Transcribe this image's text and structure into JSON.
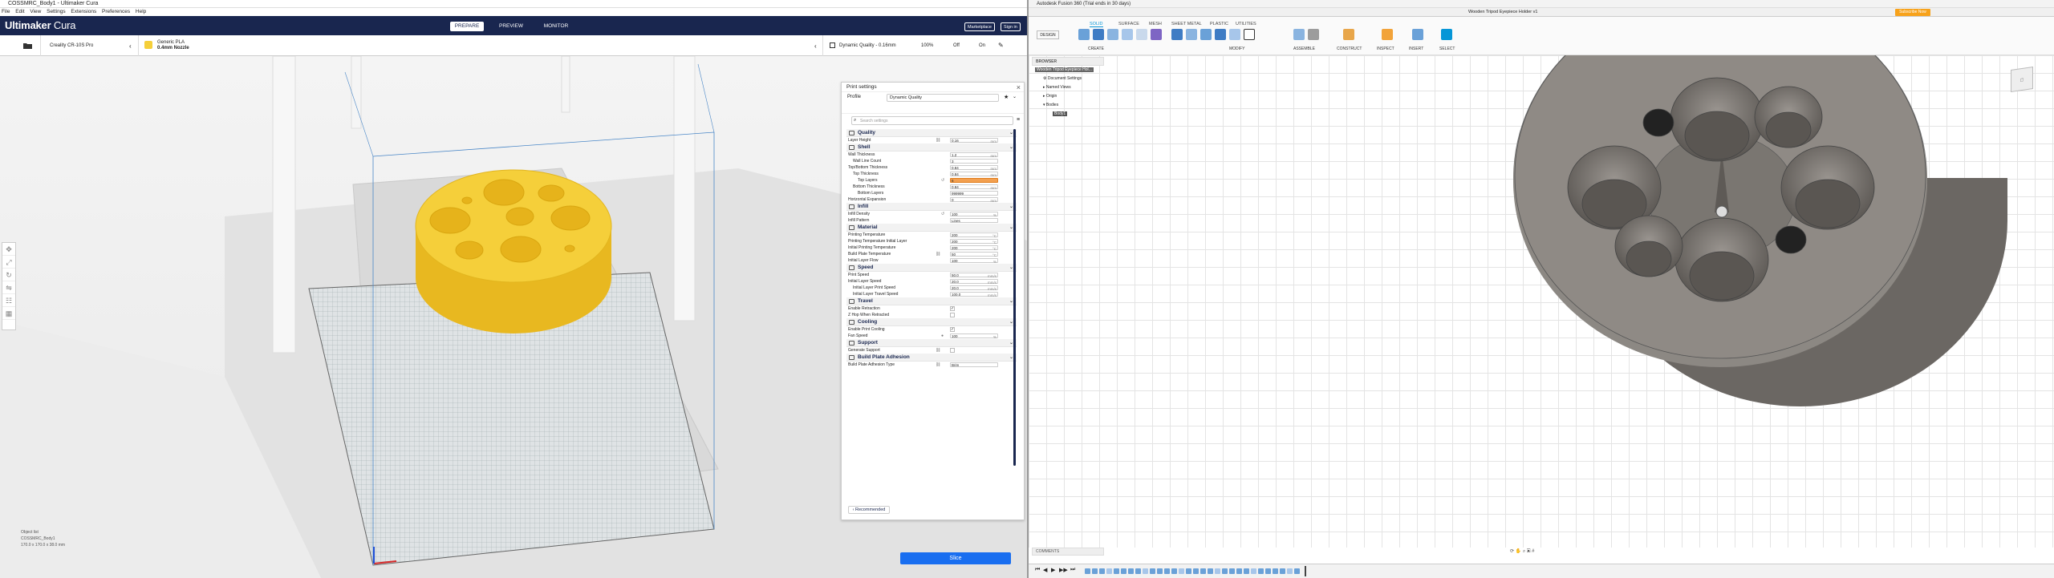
{
  "cura": {
    "window_title": "COSSMRC_Body1 - Ultimaker Cura",
    "menu": [
      "File",
      "Edit",
      "View",
      "Settings",
      "Extensions",
      "Preferences",
      "Help"
    ],
    "logo_brand": "Ultimaker",
    "logo_product": "Cura",
    "stages": [
      "PREPARE",
      "PREVIEW",
      "MONITOR"
    ],
    "marketplace": "Marketplace",
    "sign_in": "Sign in",
    "printer": "Creality CR-10S Pro",
    "material_line1": "Generic PLA",
    "material_line2": "0.4mm Nozzle",
    "quality_summary": "Dynamic Quality - 0.16mm",
    "infill_pct": "100%",
    "support": "Off",
    "adhesion": "On",
    "print_settings": {
      "title": "Print settings",
      "profile_label": "Profile",
      "profile_value": "Dynamic Quality",
      "search_placeholder": "Search settings",
      "recommended": "Recommended"
    },
    "settings": [
      {
        "t": "cat",
        "label": "Quality"
      },
      {
        "t": "row",
        "label": "Layer Height",
        "value": "0.16",
        "unit": "mm",
        "icon": "link"
      },
      {
        "t": "cat",
        "label": "Shell"
      },
      {
        "t": "row",
        "label": "Wall Thickness",
        "value": "1.2",
        "unit": "mm"
      },
      {
        "t": "row",
        "label": "Wall Line Count",
        "value": "3",
        "unit": "",
        "ind": 1
      },
      {
        "t": "row",
        "label": "Top/Bottom Thickness",
        "value": "0.84",
        "unit": "mm"
      },
      {
        "t": "row",
        "label": "Top Thickness",
        "value": "0.84",
        "unit": "mm",
        "ind": 1
      },
      {
        "t": "row",
        "label": "Top Layers",
        "value": "6",
        "unit": "",
        "ind": 2,
        "hl": true,
        "icon": "reset"
      },
      {
        "t": "row",
        "label": "Bottom Thickness",
        "value": "0.84",
        "unit": "mm",
        "ind": 1
      },
      {
        "t": "row",
        "label": "Bottom Layers",
        "value": "999999",
        "unit": "",
        "ind": 2
      },
      {
        "t": "row",
        "label": "Horizontal Expansion",
        "value": "0",
        "unit": "mm"
      },
      {
        "t": "cat",
        "label": "Infill"
      },
      {
        "t": "row",
        "label": "Infill Density",
        "value": "100",
        "unit": "%",
        "icon": "reset"
      },
      {
        "t": "row",
        "label": "Infill Pattern",
        "value": "Lines",
        "unit": ""
      },
      {
        "t": "cat",
        "label": "Material"
      },
      {
        "t": "row",
        "label": "Printing Temperature",
        "value": "200",
        "unit": "°C"
      },
      {
        "t": "row",
        "label": "Printing Temperature Initial Layer",
        "value": "200",
        "unit": "°C"
      },
      {
        "t": "row",
        "label": "Initial Printing Temperature",
        "value": "200",
        "unit": "°C"
      },
      {
        "t": "row",
        "label": "Build Plate Temperature",
        "value": "50",
        "unit": "°C",
        "icon": "link"
      },
      {
        "t": "row",
        "label": "Initial Layer Flow",
        "value": "100",
        "unit": "%"
      },
      {
        "t": "cat",
        "label": "Speed"
      },
      {
        "t": "row",
        "label": "Print Speed",
        "value": "50.0",
        "unit": "mm/s"
      },
      {
        "t": "row",
        "label": "Initial Layer Speed",
        "value": "20.0",
        "unit": "mm/s"
      },
      {
        "t": "row",
        "label": "Initial Layer Print Speed",
        "value": "20.0",
        "unit": "mm/s",
        "ind": 1
      },
      {
        "t": "row",
        "label": "Initial Layer Travel Speed",
        "value": "100.0",
        "unit": "mm/s",
        "ind": 1
      },
      {
        "t": "cat",
        "label": "Travel"
      },
      {
        "t": "row",
        "label": "Enable Retraction",
        "check": true
      },
      {
        "t": "row",
        "label": "Z Hop When Retracted",
        "check": false
      },
      {
        "t": "cat",
        "label": "Cooling"
      },
      {
        "t": "row",
        "label": "Enable Print Cooling",
        "check": true
      },
      {
        "t": "row",
        "label": "Fan Speed",
        "value": "100",
        "unit": "%",
        "icon": "info"
      },
      {
        "t": "cat",
        "label": "Support"
      },
      {
        "t": "row",
        "label": "Generate Support",
        "check": false,
        "icon": "link"
      },
      {
        "t": "cat",
        "label": "Build Plate Adhesion"
      },
      {
        "t": "row",
        "label": "Build Plate Adhesion Type",
        "value": "Brim",
        "unit": "",
        "icon": "link"
      }
    ],
    "object_list_title": "Object list",
    "object_name": "COSSMRC_Body1",
    "object_dims": "170.0 x 170.0 x 38.0 mm",
    "slice": "Slice"
  },
  "fusion": {
    "window_title": "Autodesk Fusion 360 (Trial ends in 30 days)",
    "doc_tab": "Wooden Tripod Eyepiece Holder v1",
    "ribbon_tabs": [
      "SOLID",
      "SURFACE",
      "MESH",
      "SHEET METAL",
      "PLASTIC",
      "UTILITIES"
    ],
    "design_btn": "DESIGN",
    "groups": [
      "CREATE",
      "MODIFY",
      "ASSEMBLE",
      "CONSTRUCT",
      "INSPECT",
      "INSERT",
      "SELECT"
    ],
    "browser_title": "BROWSER",
    "browser_items": [
      "Wooden Tripod Eyepiece Hol...",
      "Document Settings",
      "Named Views",
      "Origin",
      "Bodies",
      "Body1"
    ],
    "comments": "COMMENTS",
    "trial_btn": "Subscribe Now",
    "colors": {
      "accent": "#0696d7",
      "cura_header": "#19264f",
      "cura_slice": "#196ef0",
      "model_yellow": "#f5cf3a"
    }
  }
}
